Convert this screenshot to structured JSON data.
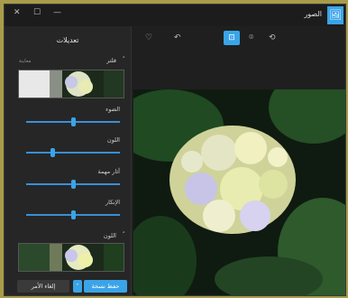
{
  "window": {
    "app_title": "الصور"
  },
  "panel": {
    "title": "تعديلات",
    "filter_section": "فلتر",
    "filter_hint": "معاينة",
    "sliders": [
      {
        "label": "الضوء",
        "value": 0.5
      },
      {
        "label": "اللون",
        "value": 0.28
      },
      {
        "label": "آثار مهمة",
        "value": 0.5
      },
      {
        "label": "الإنكار",
        "value": 0.5
      }
    ],
    "bottom_section": "اللون",
    "save_label": "حفظ نسخة",
    "cancel_label": "إلغاء الأمر"
  },
  "toolbar": {
    "icons": [
      "heart-icon",
      "undo-icon",
      "crop-icon",
      "location-icon",
      "rotate-icon"
    ]
  },
  "colors": {
    "accent": "#3aa4e8"
  }
}
